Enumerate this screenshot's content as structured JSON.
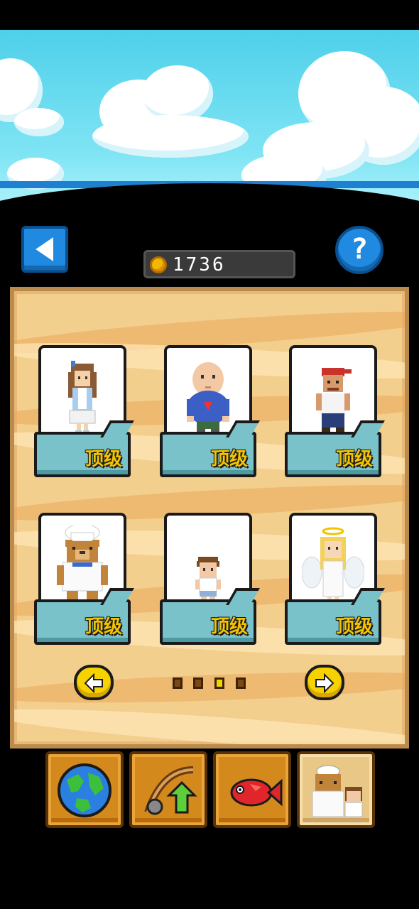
{
  "coins": {
    "count": "1736",
    "icon": "coin-icon"
  },
  "header": {
    "help_label": "?",
    "back_icon": "triangle-left-icon"
  },
  "characters": [
    {
      "name": "girl-in-blue",
      "label": "顶级"
    },
    {
      "name": "chubby-man",
      "label": "顶级"
    },
    {
      "name": "bandana-man",
      "label": "顶级"
    },
    {
      "name": "bear-chef",
      "label": "顶级"
    },
    {
      "name": "boy",
      "label": "顶级"
    },
    {
      "name": "angel",
      "label": "顶级"
    }
  ],
  "pager": {
    "pages": 4,
    "current": 3,
    "prev_icon": "arrow-left-icon",
    "next_icon": "arrow-right-icon"
  },
  "bottom_tabs": [
    {
      "name": "world",
      "icon": "globe-icon",
      "selected": false
    },
    {
      "name": "upgrade-rod",
      "icon": "fishing-rod-upgrade-icon",
      "selected": false
    },
    {
      "name": "fish",
      "icon": "red-fish-icon",
      "selected": false
    },
    {
      "name": "characters",
      "icon": "bear-chef-and-boy-icon",
      "selected": true
    }
  ],
  "colors": {
    "accent_blue": "#1f8ae0",
    "label_yellow": "#f4c400",
    "tab_teal": "#7ac2c9",
    "sand": "#f3cf8e"
  }
}
